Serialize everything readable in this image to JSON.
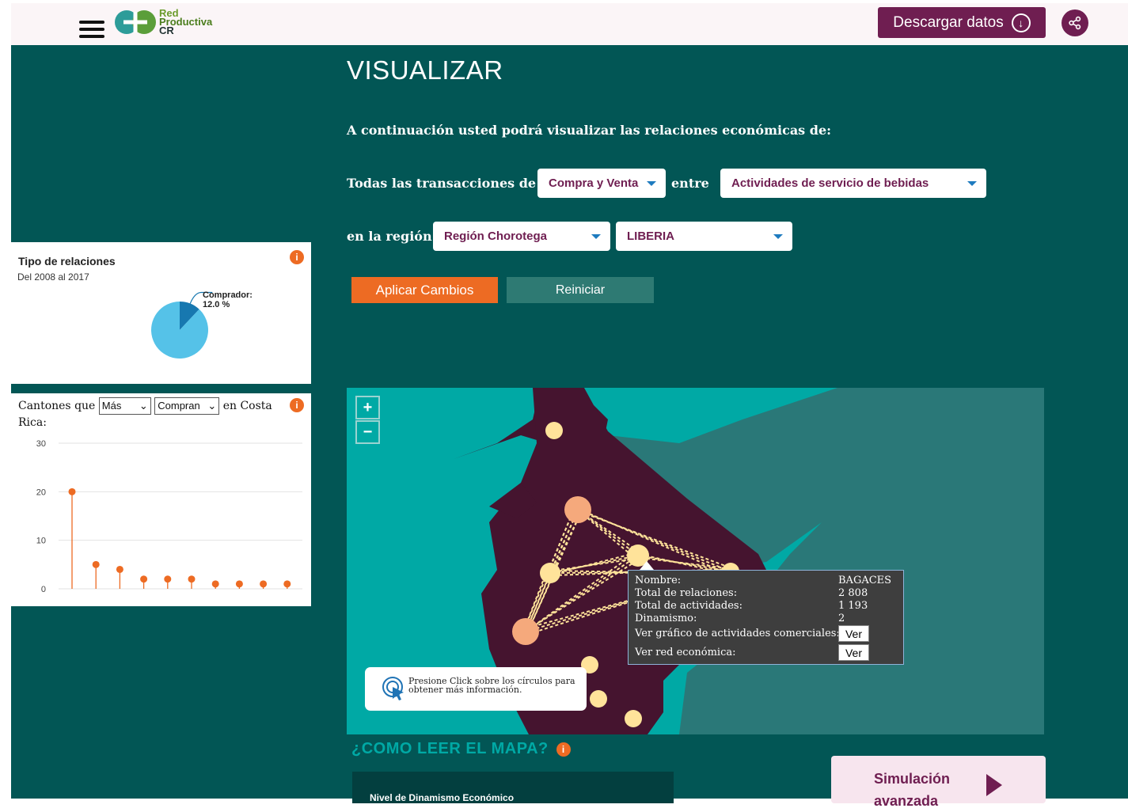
{
  "header": {
    "logo": {
      "line1": "Red",
      "line2": "Productiva",
      "line3": "CR"
    },
    "download_label": "Descargar datos"
  },
  "main": {
    "title": "VISUALIZAR",
    "intro": "A continuación usted podrá visualizar las relaciones económicas de:",
    "row1_prefix": "Todas las transacciones de",
    "transaction_type": "Compra y Venta",
    "row1_between": "entre",
    "activity": "Actividades de servicio de bebidas",
    "row2_prefix": "en la región",
    "region": "Región Chorotega",
    "canton": "LIBERIA",
    "apply_label": "Aplicar Cambios",
    "reset_label": "Reiniciar"
  },
  "relations_panel": {
    "title": "Tipo de relaciones",
    "subtitle": "Del 2008 al 2017",
    "slice_label": "Comprador:",
    "slice_value": "12.0 %",
    "chart_data": {
      "type": "pie",
      "title": "Tipo de relaciones",
      "slices": [
        {
          "label": "Comprador",
          "value": 12.0,
          "color": "#1778b0"
        },
        {
          "label": "",
          "value": 88.0,
          "color": "#55c2e8"
        }
      ]
    }
  },
  "cantons_panel": {
    "prefix": "Cantones que",
    "select1_value": "Más",
    "select2_value": "Compran",
    "suffix": "en Costa Rica:",
    "y_ticks": [
      "30",
      "20",
      "10",
      "0"
    ],
    "chart_data": {
      "type": "scatter",
      "style": "lollipop",
      "ylim": [
        0,
        30
      ],
      "x": [
        1,
        2,
        3,
        4,
        5,
        6,
        7,
        8,
        9,
        10
      ],
      "values": [
        20,
        5,
        4,
        2,
        2,
        2,
        1,
        1,
        1,
        1
      ],
      "color": "#ed6b23",
      "grid": true
    }
  },
  "map": {
    "zoom_in": "+",
    "zoom_out": "−",
    "tooltip": {
      "rows": [
        {
          "label": "Nombre:",
          "value": "BAGACES"
        },
        {
          "label": "Total de relaciones:",
          "value": "2 808"
        },
        {
          "label": "Total de actividades:",
          "value": "1 193"
        },
        {
          "label": "Dinamismo:",
          "value": "2"
        }
      ],
      "chart_link_label": "Ver gráfico de actividades comerciales:",
      "network_link_label": "Ver red económica:",
      "ver_label": "Ver"
    },
    "hint": "Presione Click sobre los círculos para obtener más información."
  },
  "how_to_read": "¿COMO LEER EL MAPA?",
  "legend_title": "Nivel de Dinamismo Económico",
  "simulation_label": "Simulación avanzada",
  "colors": {
    "brand": "#6f1e51",
    "accent": "#ed6b23",
    "background": "#025655",
    "map_sea": "#00a9a5",
    "map_region": "#45142f"
  }
}
